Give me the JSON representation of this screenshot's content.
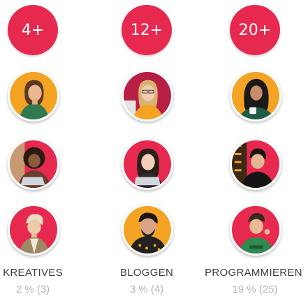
{
  "colors": {
    "accent": "#e8294f",
    "orange": "#f5a324",
    "title_text": "#3d3d3d",
    "stat_text": "#b5b5b5"
  },
  "columns": [
    {
      "badge": "4+",
      "title": "KREATIVES",
      "stat": "2 % (3)",
      "avatars": [
        "orange",
        "red",
        "red"
      ]
    },
    {
      "badge": "12+",
      "title": "BLOGGEN",
      "stat": "3 % (4)",
      "avatars": [
        "red",
        "red",
        "orange"
      ]
    },
    {
      "badge": "20+",
      "title": "PROGRAMMIEREN",
      "stat": "19 % (25)",
      "avatars": [
        "orange",
        "red",
        "red"
      ]
    }
  ]
}
